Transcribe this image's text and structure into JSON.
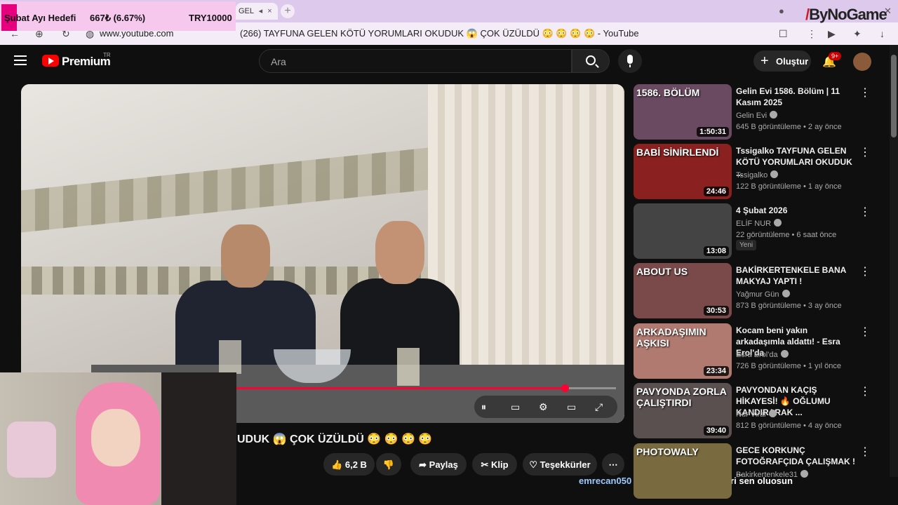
{
  "browser": {
    "tab_label": "GEL",
    "url": "www.youtube.com",
    "page_title": "(266) TAYFUNA GELEN KÖTÜ YORUMLARI OKUDUK 😱 ÇOK ÜZÜLDÜ 😳 😳 😳 😳 - YouTube"
  },
  "overlay": {
    "goal_label": "Şubat Ayı Hedefi",
    "goal_progress": "667₺ (6.67%)",
    "goal_target": "TRY10000",
    "brand": "ByNoGame"
  },
  "header": {
    "logo_text": "Premium",
    "logo_region": "TR",
    "search_placeholder": "Ara",
    "create_label": "Oluştur",
    "notif_badge": "9+"
  },
  "video": {
    "title_visible": "UDUK 😱 ÇOK ÜZÜLDÜ 😳 😳 😳 😳",
    "progress": 0.865,
    "like_count": "6,2 B",
    "share_label": "Paylaş",
    "clip_label": "Klip",
    "thanks_label": "Teşekkürler"
  },
  "chat": {
    "user": "emrecan050",
    "message": ": daha gariban dedikleri sen oluosun"
  },
  "recommendations": [
    {
      "title": "Gelin Evi 1586. Bölüm | 11 Kasım 2025",
      "channel": "Gelin Evi",
      "meta": "645 B görüntüleme • 2 ay önce",
      "duration": "1:50:31",
      "thumb_text": "1586. BÖLÜM",
      "thumb_color": "#6a4a60"
    },
    {
      "title": "Tssigalko TAYFUNA GELEN KÖTÜ YORUMLARI OKUDUK ...",
      "channel": "Tssigalko",
      "meta": "122 B görüntüleme • 1 ay önce",
      "duration": "24:46",
      "thumb_text": "BABİ SİNİRLENDİ",
      "thumb_color": "#8a2020"
    },
    {
      "title": "4 Şubat 2026",
      "channel": "ELİF NUR",
      "meta": "22 görüntüleme • 6 saat önce",
      "duration": "13:08",
      "thumb_text": "",
      "thumb_color": "#444444",
      "badge": "Yeni"
    },
    {
      "title": "BAKİRKERTENKELE BANA MAKYAJ YAPTI !",
      "channel": "Yağmur Gün",
      "meta": "873 B görüntüleme • 3 ay önce",
      "duration": "30:53",
      "thumb_text": "ABOUT US",
      "thumb_color": "#7a4a4a"
    },
    {
      "title": "Kocam beni yakın arkadaşımla aldattı! - Esra Erol'da",
      "channel": "Esra Erol'da",
      "meta": "726 B görüntüleme • 1 yıl önce",
      "duration": "23:34",
      "thumb_text": "ARKADAŞIMIN AŞKISI",
      "thumb_color": "#b07a70"
    },
    {
      "title": "PAVYONDAN KAÇIŞ HİKAYESİ! 🔥 OĞLUMU KANDIRARAK ...",
      "channel": "Nur Viral",
      "meta": "812 B görüntüleme • 4 ay önce",
      "duration": "39:40",
      "thumb_text": "PAVYONDA ZORLA ÇALIŞTIRDI",
      "thumb_color": "#5a5050"
    },
    {
      "title": "GECE KORKUNÇ FOTOĞRAFÇIDA ÇALIŞMAK ! ...",
      "channel": "Bakirkertenkele31",
      "meta": "",
      "duration": "",
      "thumb_text": "PHOTOWALY",
      "thumb_color": "#7a6a40"
    }
  ]
}
